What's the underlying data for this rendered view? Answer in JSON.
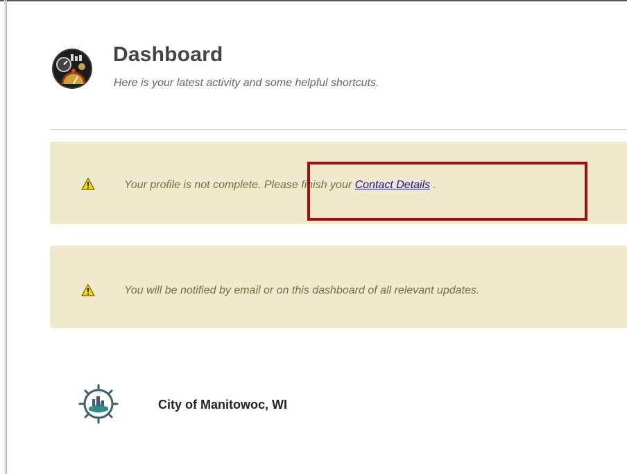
{
  "header": {
    "title": "Dashboard",
    "subtitle": "Here is your latest activity and some helpful shortcuts."
  },
  "alerts": [
    {
      "icon": "warning-icon",
      "text_before": "Your profile is not complete. Please finish your ",
      "link_text": "Contact Details",
      "text_after": " ."
    },
    {
      "icon": "warning-icon",
      "text": "You will be notified by email or on this dashboard of all relevant updates."
    }
  ],
  "organization": {
    "name": "City of Manitowoc, WI",
    "logo": "city-seal-icon"
  },
  "colors": {
    "alert_background": "#efeacd",
    "alert_text": "#7a6c3c",
    "link": "#1a0dab",
    "highlight_border": "#a30f0f",
    "warning_yellow": "#f5d800"
  }
}
